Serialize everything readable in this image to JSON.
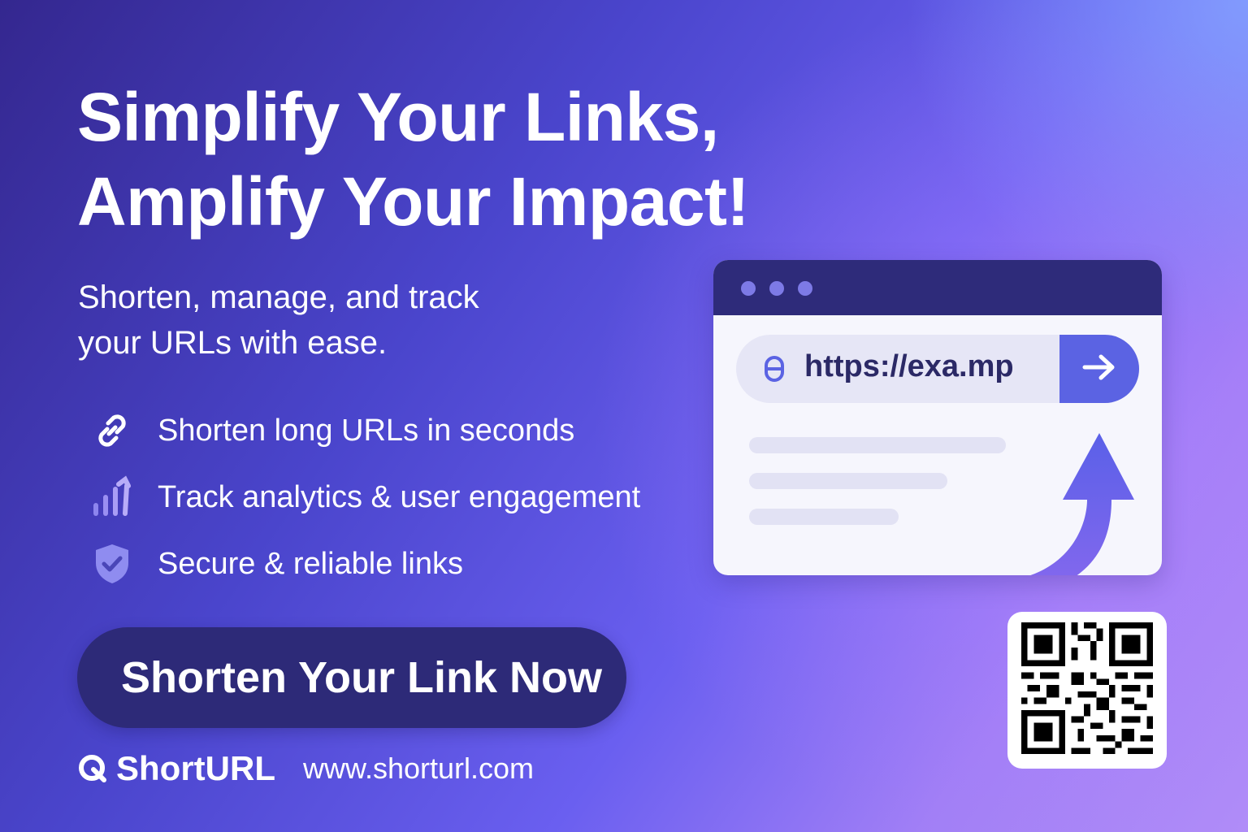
{
  "headline": {
    "line1": "Simplify Your Links,",
    "line2": "Amplify Your Impact!"
  },
  "subhead": {
    "line1": "Shorten, manage, and track",
    "line2": "your URLs with ease."
  },
  "features": [
    {
      "icon": "link-icon",
      "text": "Shorten long URLs in seconds"
    },
    {
      "icon": "analytics-icon",
      "text": "Track analytics & user engagement"
    },
    {
      "icon": "shield-check-icon",
      "text": "Secure & reliable links"
    }
  ],
  "cta": {
    "label": "Shorten Your Link Now"
  },
  "brand": {
    "name": "ShortURL",
    "url": "www.shorturl.com"
  },
  "browser_mock": {
    "url_text": "https://exa.mp",
    "go_icon": "arrow-right-icon",
    "lock_icon": "lock-icon",
    "growth_icon": "curved-up-arrow-icon"
  },
  "qr": {
    "icon": "qr-code-icon"
  },
  "colors": {
    "bg_start": "#34278f",
    "bg_end": "#b08cf8",
    "cta_bg": "#2d2a78",
    "accent": "#5b63e3",
    "browser_bar": "#2e2b7a"
  }
}
